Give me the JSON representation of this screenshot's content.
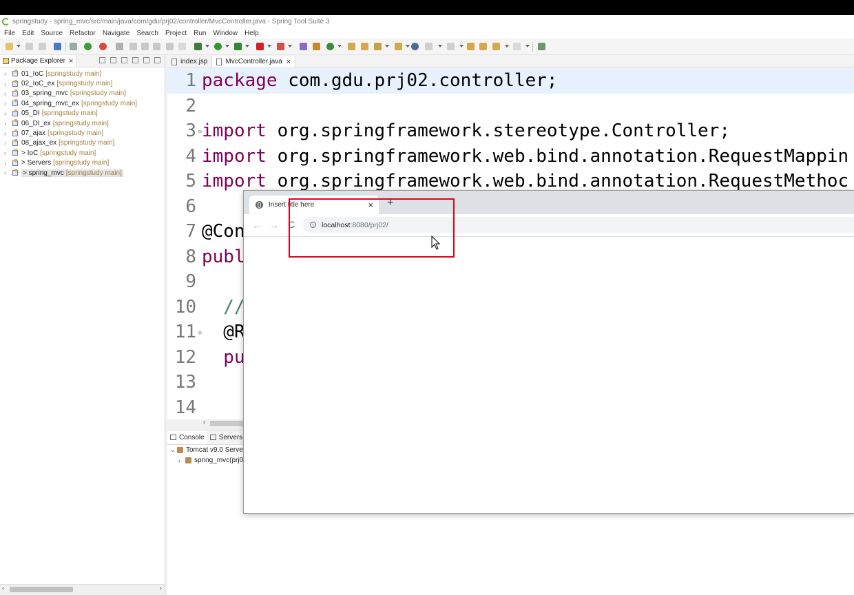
{
  "window": {
    "title": "springstudy - spring_mvc/src/main/java/com/gdu/prj02/controller/MvcController.java - Spring Tool Suite 3"
  },
  "menu": [
    "File",
    "Edit",
    "Source",
    "Refactor",
    "Navigate",
    "Search",
    "Project",
    "Run",
    "Window",
    "Help"
  ],
  "explorer": {
    "tab_label": "Package Explorer",
    "close": "×",
    "projects": [
      {
        "name": "01_IoC",
        "repo": "[springstudy main]"
      },
      {
        "name": "02_IoC_ex",
        "repo": "[springstudy main]"
      },
      {
        "name": "03_spring_mvc",
        "repo": "[springstudy main]"
      },
      {
        "name": "04_spring_mvc_ex",
        "repo": "[springstudy main]"
      },
      {
        "name": "05_DI",
        "repo": "[springstudy main]"
      },
      {
        "name": "06_DI_ex",
        "repo": "[springstudy main]"
      },
      {
        "name": "07_ajax",
        "repo": "[springstudy main]"
      },
      {
        "name": "08_ajax_ex",
        "repo": "[springstudy main]"
      },
      {
        "name": "> IoC",
        "repo": "[springstudy main]"
      },
      {
        "name": "> Servers",
        "repo": "[springstudy main]"
      },
      {
        "name": "> spring_mvc",
        "repo": "[springstudy main]"
      }
    ]
  },
  "editor": {
    "tabs": [
      {
        "label": "index.jsp"
      },
      {
        "label": "MvcController.java",
        "close": "×"
      }
    ],
    "lines": [
      {
        "n": "1",
        "kw": "package",
        "rest": " com.gdu.prj02.controller;"
      },
      {
        "n": "2",
        "kw": "",
        "rest": ""
      },
      {
        "n": "3",
        "kw": "import",
        "rest": " org.springframework.stereotype.Controller;"
      },
      {
        "n": "4",
        "kw": "import",
        "rest": " org.springframework.web.bind.annotation.RequestMappin"
      },
      {
        "n": "5",
        "kw": "import",
        "rest": " org.springframework.web.bind.annotation.RequestMethoc"
      },
      {
        "n": "6",
        "kw": "",
        "rest": ""
      },
      {
        "n": "7",
        "kw": "",
        "rest": "@Con"
      },
      {
        "n": "8",
        "kw": "publ",
        "rest": ""
      },
      {
        "n": "9",
        "kw": "",
        "rest": ""
      },
      {
        "n": "10",
        "kw": "",
        "rest": "  //"
      },
      {
        "n": "11",
        "kw": "",
        "rest": "  @R"
      },
      {
        "n": "12",
        "kw": "  pu",
        "rest": ""
      },
      {
        "n": "13",
        "kw": "",
        "rest": ""
      },
      {
        "n": "14",
        "kw": "",
        "rest": ""
      }
    ]
  },
  "bottom": {
    "tabs": [
      "Console",
      "Servers"
    ],
    "server": "Tomcat v9.0 Serve",
    "module": "spring_mvc(prj0"
  },
  "browser": {
    "tab_title": "Insert title here",
    "close": "×",
    "new_tab": "+",
    "back": "←",
    "forward": "→",
    "reload": "C",
    "url_host": "localhost",
    "url_path": ":8080/prj02/"
  }
}
